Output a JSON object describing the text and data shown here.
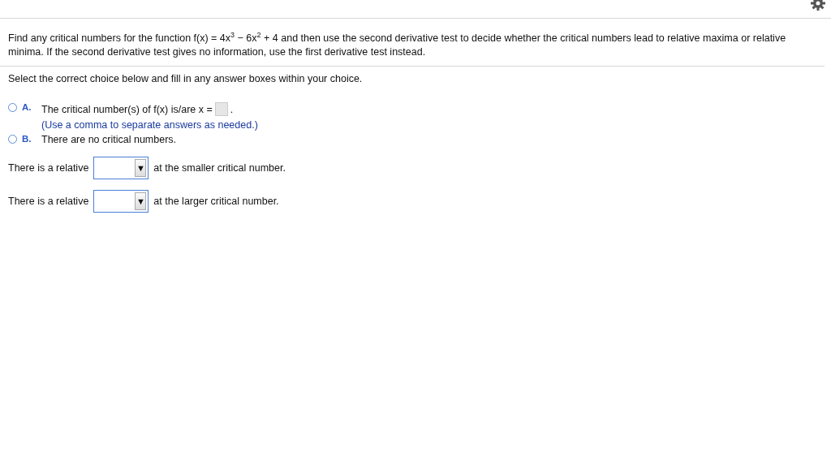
{
  "question": "Find any critical numbers for the function f(x) = 4x$^{3}$ − 6x$^{2}$ + 4 and then use the second derivative test to decide whether the critical numbers lead to relative maxima or relative minima. If the second derivative test gives no information, use the first derivative test instead.",
  "instruction": "Select the correct choice below and fill in any answer boxes within your choice.",
  "choices": [
    {
      "letter": "A.",
      "selected": false,
      "kind": "answer",
      "text": "The critical number(s) of f(x) is/are x =",
      "after": ".",
      "hint": "(Use a comma to separate answers as needed.)"
    },
    {
      "letter": "B.",
      "selected": false,
      "kind": "plain",
      "text": "There are no critical numbers."
    }
  ],
  "dropdowns": [
    {
      "before": "There is a relative",
      "after": "at the smaller critical number.",
      "arrow": "▼"
    },
    {
      "before": "There is a relative",
      "after": "at the larger critical number.",
      "arrow": "▼"
    }
  ]
}
